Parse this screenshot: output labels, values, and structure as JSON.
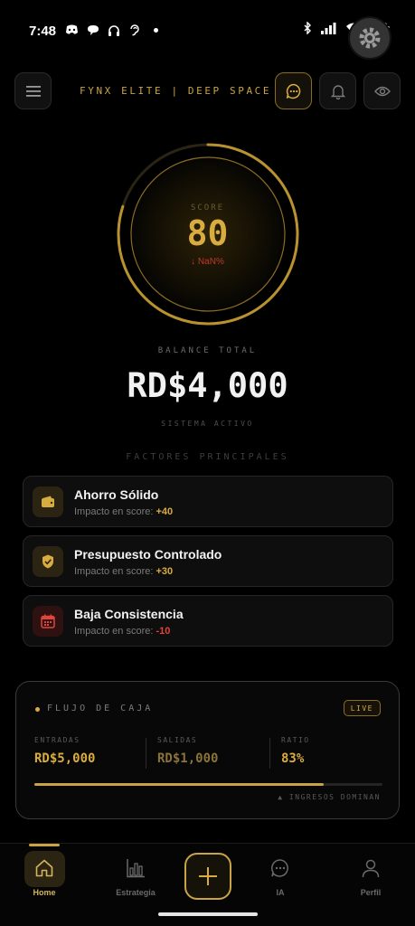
{
  "status_bar": {
    "time": "7:48",
    "left_icons": [
      "discord-icon",
      "chat-bubble-icon",
      "headphones-icon",
      "hearing-icon",
      "dot-icon"
    ],
    "right_icons": [
      "bluetooth-icon",
      "signal-icon",
      "wifi-icon",
      "battery-icon"
    ]
  },
  "header": {
    "brand": "FYNX ELITE | DEEP SPACE",
    "buttons": [
      "menu-icon",
      "chat-icon",
      "bell-icon",
      "eye-icon"
    ]
  },
  "score": {
    "label": "SCORE",
    "value": "80",
    "change": "↓ NaN%",
    "ring_fraction": 0.8
  },
  "balance": {
    "label": "BALANCE TOTAL",
    "value": "RD$4,000",
    "status": "SISTEMA ACTIVO"
  },
  "factors": {
    "title": "FACTORES PRINCIPALES",
    "impact_prefix": "Impacto en score:",
    "items": [
      {
        "name": "Ahorro Sólido",
        "impact": "+40",
        "icon": "wallet-icon",
        "color": "#d9ac3f"
      },
      {
        "name": "Presupuesto Controlado",
        "impact": "+30",
        "icon": "shield-check-icon",
        "color": "#d9ac3f"
      },
      {
        "name": "Baja Consistencia",
        "impact": "-10",
        "icon": "calendar-icon",
        "color": "#e0443a"
      }
    ]
  },
  "cash_flow": {
    "title": "FLUJO DE CAJA",
    "badge": "LIVE",
    "entradas_label": "ENTRADAS",
    "entradas_value": "RD$5,000",
    "salidas_label": "SALIDAS",
    "salidas_value": "RD$1,000",
    "ratio_label": "RATIO",
    "ratio_value": "83%",
    "ratio_fraction": 0.83,
    "note": "▲ INGRESOS DOMINAN"
  },
  "nav": {
    "home": "Home",
    "strategy": "Estrategia",
    "ai": "IA",
    "profile": "Perfil"
  },
  "colors": {
    "gold": "#d9ac3f",
    "red": "#e0443a",
    "background": "#000000"
  }
}
